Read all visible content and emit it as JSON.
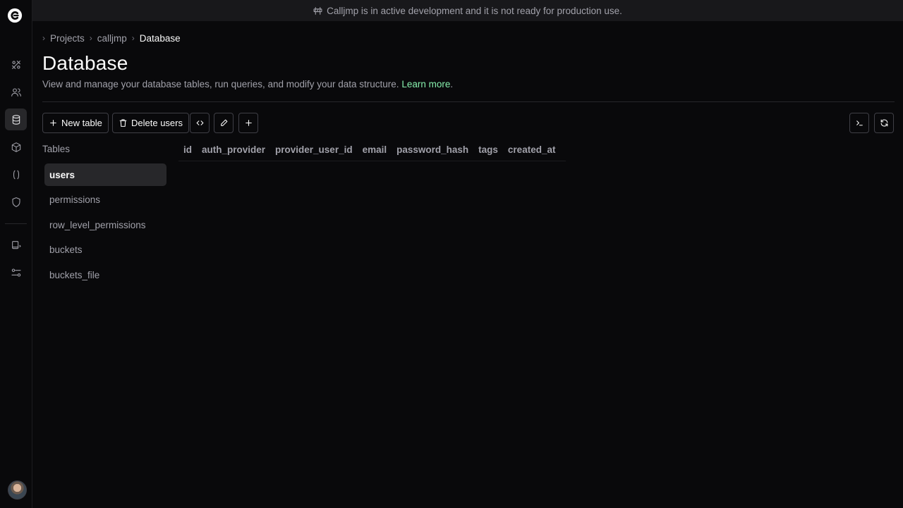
{
  "banner": {
    "text": "Calljmp is in active development and it is not ready for production use."
  },
  "breadcrumb": {
    "items": [
      "Projects",
      "calljmp",
      "Database"
    ]
  },
  "page": {
    "title": "Database",
    "description": "View and manage your database tables, run queries, and modify your data structure.",
    "learn_more": "Learn more",
    "learn_more_suffix": "."
  },
  "toolbar": {
    "new_table": "New table",
    "delete_users": "Delete users"
  },
  "tables": {
    "heading": "Tables",
    "items": [
      "users",
      "permissions",
      "row_level_permissions",
      "buckets",
      "buckets_file"
    ],
    "selected": "users"
  },
  "columns": [
    "id",
    "auth_provider",
    "provider_user_id",
    "email",
    "password_hash",
    "tags",
    "created_at"
  ],
  "sidebar": {
    "items": [
      "tools-icon",
      "users-icon",
      "database-icon",
      "box-icon",
      "functions-icon",
      "shield-icon",
      "docs-icon",
      "settings-icon"
    ],
    "active": "database-icon"
  },
  "colors": {
    "accent_link": "#86efac",
    "background": "#09090b",
    "banner_bg": "#18181b"
  }
}
